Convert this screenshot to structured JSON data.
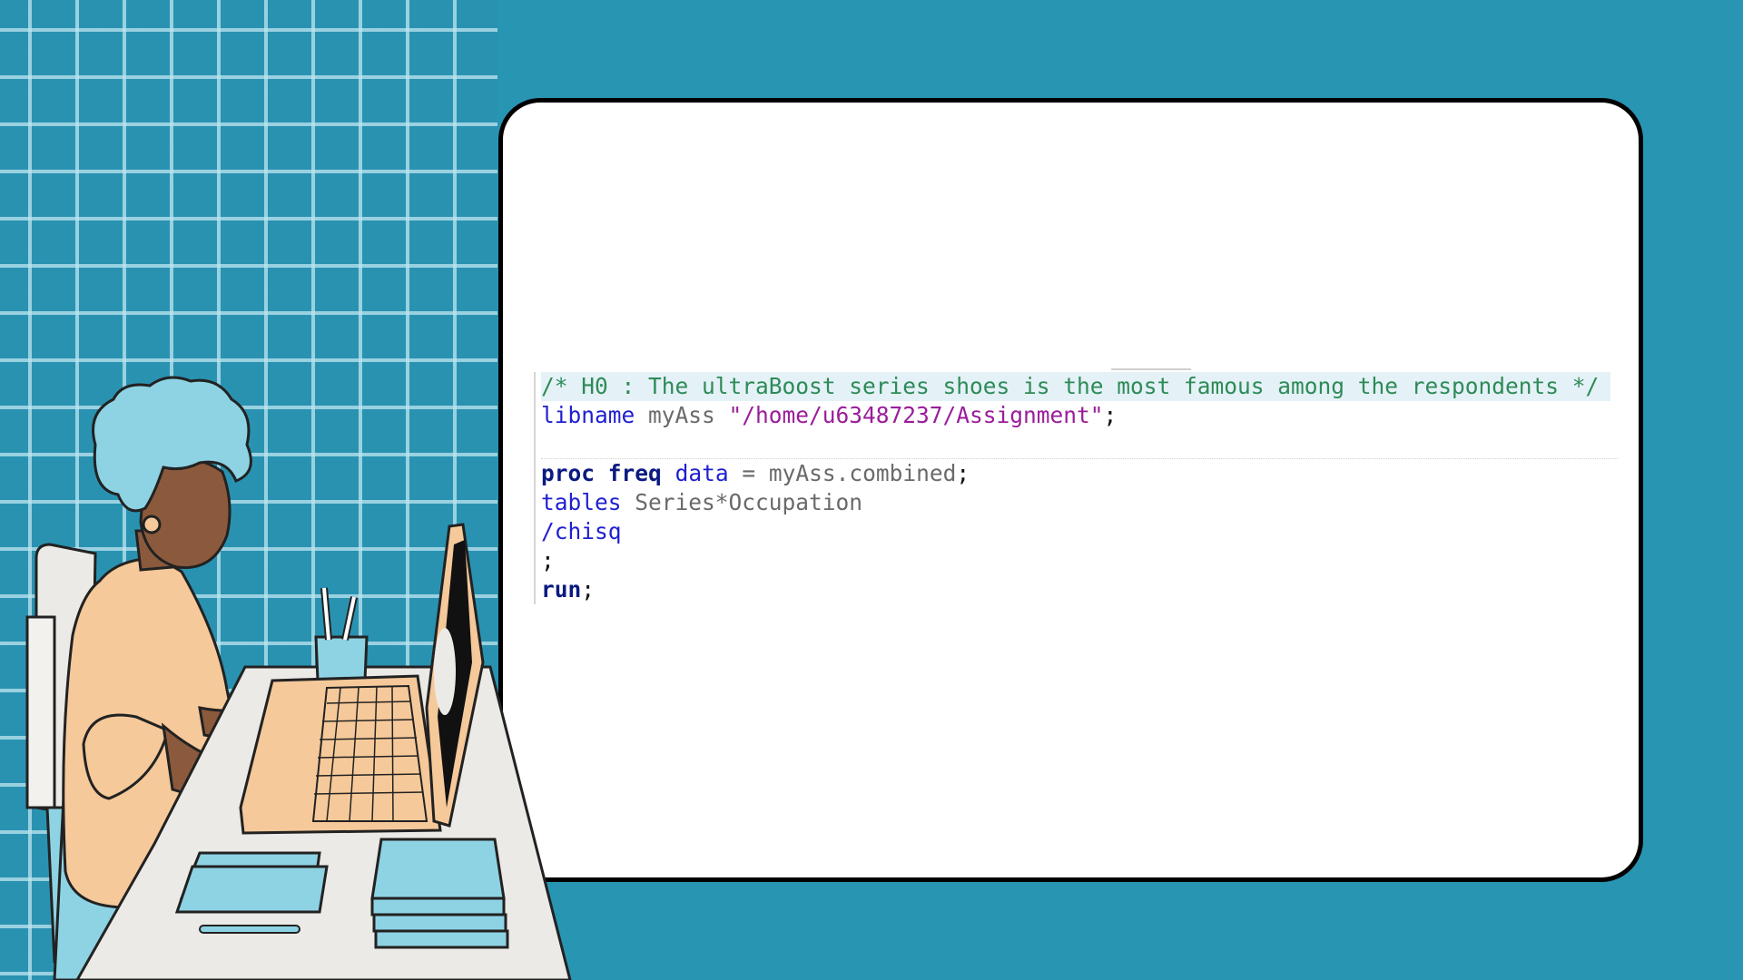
{
  "code": {
    "line1": "/* H0 : The ultraBoost series shoes is the most famous among the respondents */",
    "line2_kw": "libname",
    "line2_name": " myAss ",
    "line2_str": "\"/home/u63487237/Assignment\"",
    "line2_end": ";",
    "line4_kw1": "proc",
    "line4_kw2": "freq",
    "line4_opt": "data",
    "line4_rest": " = myAss.combined",
    "line4_end": ";",
    "line5_kw": "tables",
    "line5_rest": " Series*Occupation",
    "line6": "/chisq",
    "line7": ";",
    "line8_kw": "run",
    "line8_end": ";"
  },
  "colors": {
    "background": "#2895b3",
    "comment": "#2e8b57",
    "keyword": "#1f1fd0",
    "string": "#9a1d9a"
  },
  "illustration": "woman-typing-at-laptop-icon"
}
